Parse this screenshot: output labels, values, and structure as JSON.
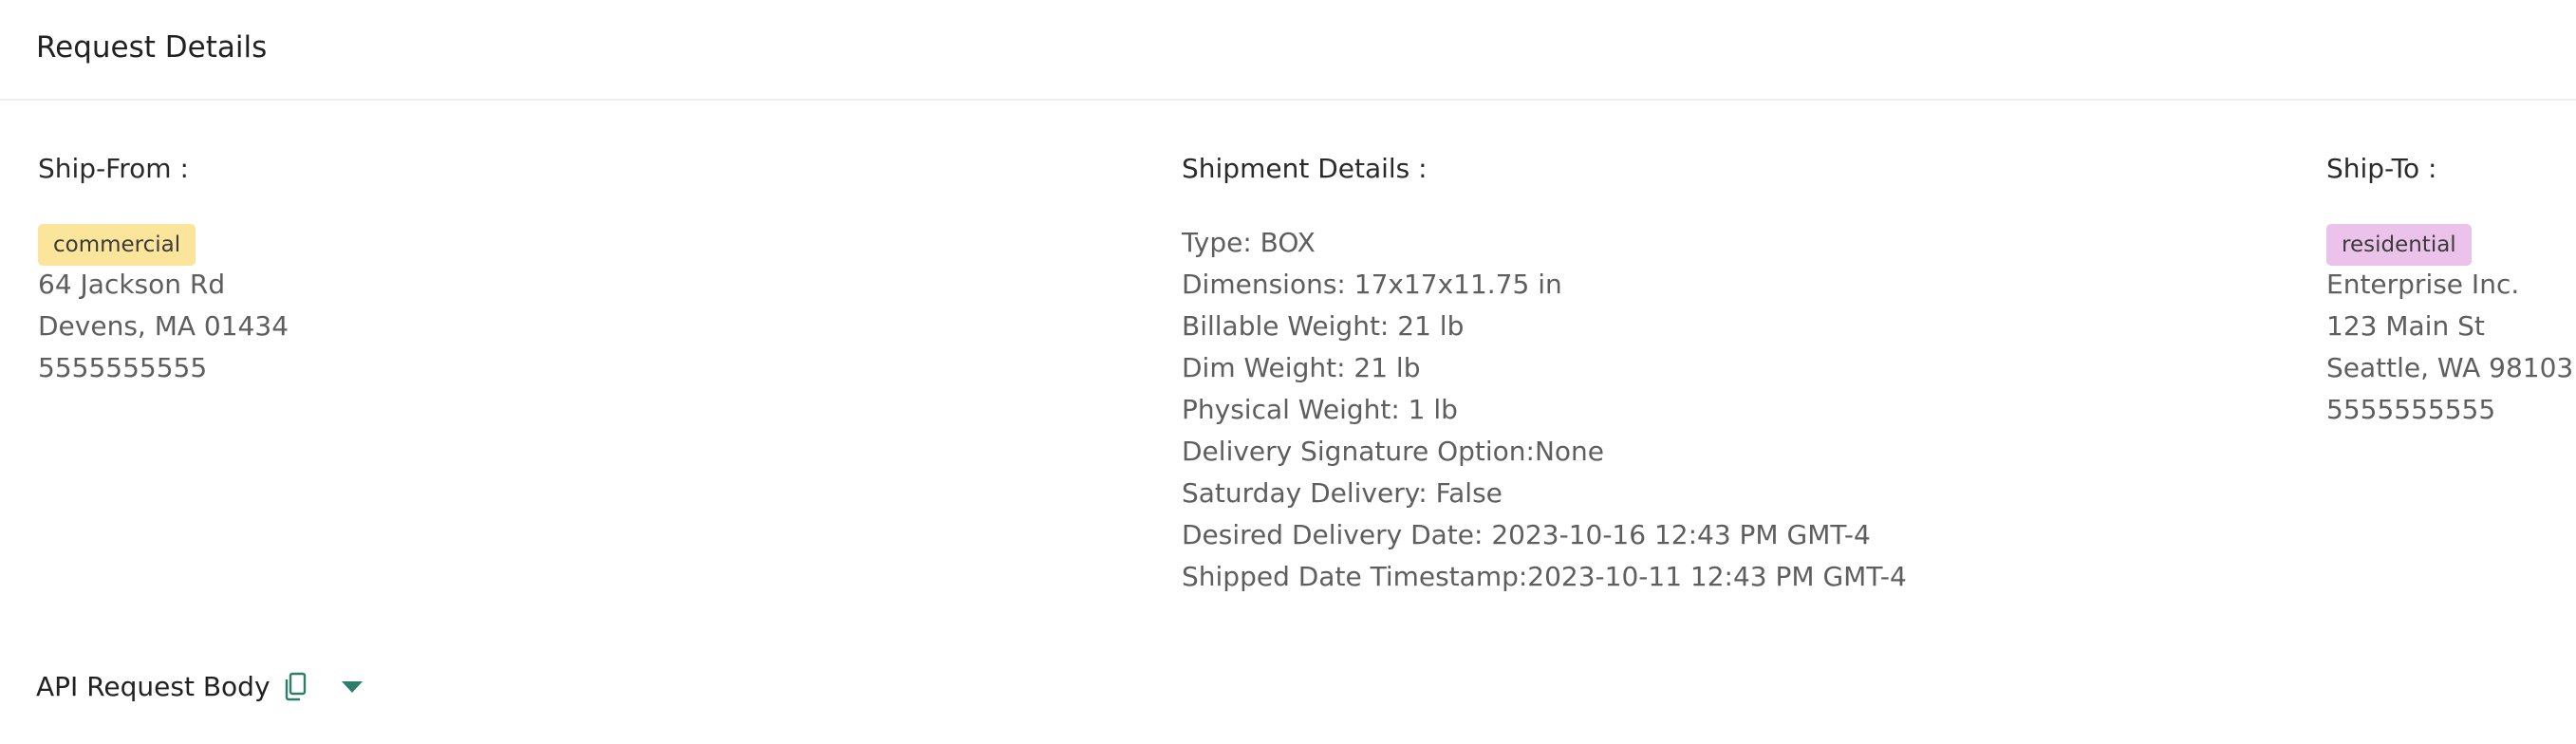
{
  "header": {
    "title": "Request Details"
  },
  "ship_from": {
    "title": "Ship-From :",
    "address_type": "commercial",
    "lines": [
      "64 Jackson Rd",
      "Devens, MA 01434",
      "5555555555"
    ]
  },
  "shipment_details": {
    "title": "Shipment Details :",
    "lines": [
      "Type: BOX",
      "Dimensions: 17x17x11.75 in",
      "Billable Weight: 21 lb",
      "Dim Weight: 21 lb",
      "Physical Weight: 1 lb",
      "Delivery Signature Option:None",
      "Saturday Delivery: False",
      "Desired Delivery Date: 2023-10-16 12:43 PM GMT-4",
      "Shipped Date Timestamp:2023-10-11 12:43 PM GMT-4"
    ]
  },
  "ship_to": {
    "title": "Ship-To :",
    "address_type": "residential",
    "lines": [
      "Enterprise Inc.",
      "123 Main St",
      "Seattle, WA 98103",
      "5555555555"
    ]
  },
  "api_request": {
    "label": "API Request Body",
    "copy_icon": "copy-icon",
    "expand_icon": "chevron-down-icon"
  },
  "colors": {
    "commercial_tag": "#fbe59b",
    "residential_tag": "#ebc3ea",
    "accent_teal": "#2e7d6b",
    "divider": "#eeeeee"
  }
}
